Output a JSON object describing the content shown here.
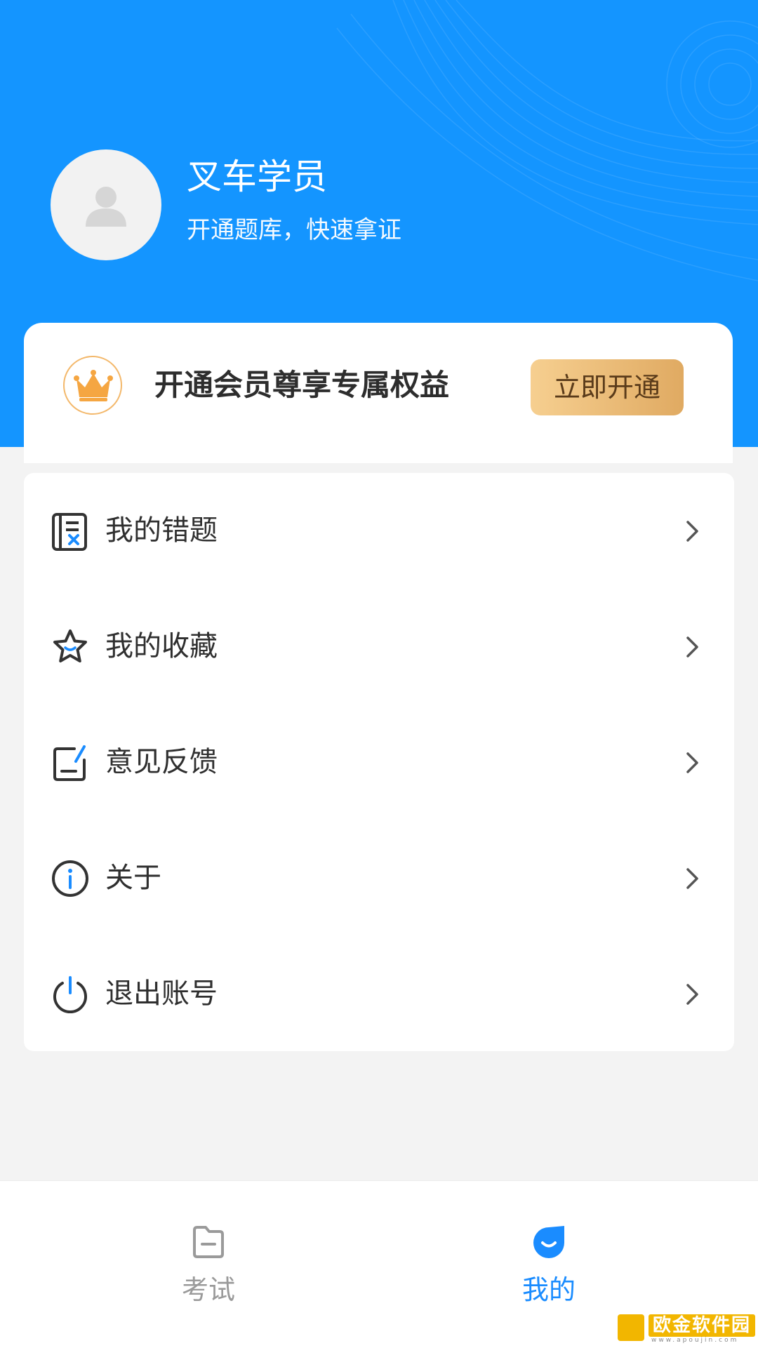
{
  "profile": {
    "name": "叉车学员",
    "subtitle": "开通题库，快速拿证",
    "avatar_icon": "user-avatar-icon"
  },
  "vip": {
    "text": "开通会员尊享专属权益",
    "button_label": "立即开通",
    "icon": "crown-icon",
    "colors": {
      "crown": "#f5a642",
      "button_start": "#f6cf90",
      "button_end": "#e0aa62"
    }
  },
  "menu": {
    "items": [
      {
        "label": "我的错题",
        "icon": "wrong-questions-icon"
      },
      {
        "label": "我的收藏",
        "icon": "star-icon"
      },
      {
        "label": "意见反馈",
        "icon": "feedback-icon"
      },
      {
        "label": "关于",
        "icon": "info-icon"
      },
      {
        "label": "退出账号",
        "icon": "power-icon"
      }
    ]
  },
  "tabbar": {
    "tabs": [
      {
        "label": "考试",
        "icon": "folder-icon",
        "active": false
      },
      {
        "label": "我的",
        "icon": "profile-drop-icon",
        "active": true
      }
    ]
  },
  "watermark": {
    "text": "欧金软件园",
    "url": "www.apoujin.com"
  },
  "colors": {
    "primary": "#1495ff",
    "accent_icon": "#1a8cff",
    "text": "#2f2f2f",
    "inactive": "#9a9a9a"
  }
}
